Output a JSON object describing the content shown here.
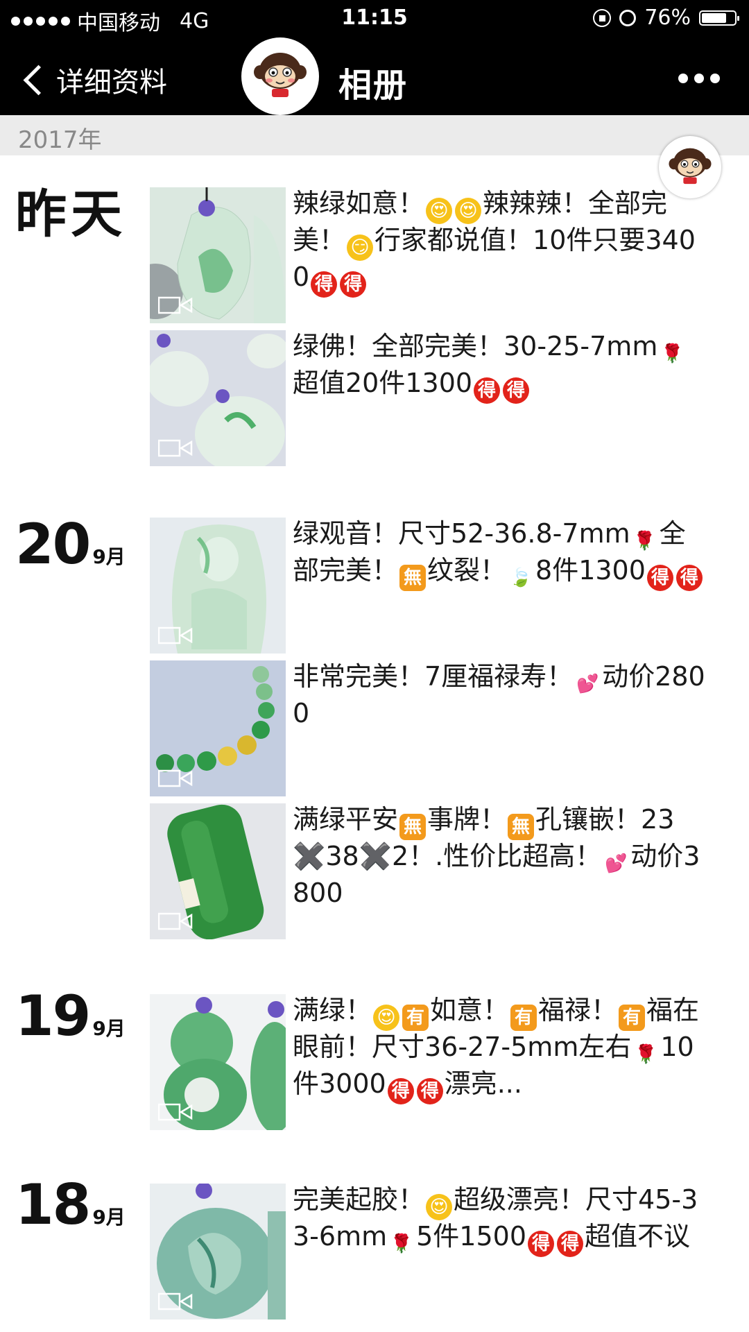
{
  "status": {
    "carrier": "中国移动",
    "network": "4G",
    "time": "11:15",
    "battery": "76%",
    "battery_level": 0.76
  },
  "nav": {
    "back_label": "详细资料",
    "title": "相册"
  },
  "year_label": "2017年",
  "days": [
    {
      "day": "昨天",
      "month": ""
    },
    {
      "day": "20",
      "month": "9月"
    },
    {
      "day": "19",
      "month": "9月"
    },
    {
      "day": "18",
      "month": "9月"
    }
  ],
  "posts": [
    {
      "segments": [
        {
          "t": "辣绿如意！"
        },
        {
          "e": "face",
          "g": "😍"
        },
        {
          "e": "face",
          "g": "😍"
        },
        {
          "t": "辣辣辣！全部完美！"
        },
        {
          "e": "face",
          "g": "😏"
        },
        {
          "t": "行家都说值！10件只要3400"
        },
        {
          "e": "de",
          "g": "得"
        },
        {
          "e": "de",
          "g": "得"
        }
      ]
    },
    {
      "segments": [
        {
          "t": "绿佛！全部完美！30-25-7mm"
        },
        {
          "e": "rose",
          "g": "🌹"
        },
        {
          "t": "超值20件1300"
        },
        {
          "e": "de",
          "g": "得"
        },
        {
          "e": "de",
          "g": "得"
        }
      ]
    },
    {
      "segments": [
        {
          "t": "绿观音！尺寸52-36.8-7mm"
        },
        {
          "e": "rose",
          "g": "🌹"
        },
        {
          "t": "全部完美！"
        },
        {
          "e": "wu",
          "g": "無"
        },
        {
          "t": "纹裂！"
        },
        {
          "e": "leaf",
          "g": "🍃"
        },
        {
          "t": "8件1300"
        },
        {
          "e": "de",
          "g": "得"
        },
        {
          "e": "de",
          "g": "得"
        }
      ]
    },
    {
      "segments": [
        {
          "t": "非常完美！7厘福禄寿！"
        },
        {
          "e": "heart",
          "g": "💕"
        },
        {
          "t": "动价2800"
        }
      ]
    },
    {
      "segments": [
        {
          "t": "满绿平安"
        },
        {
          "e": "wu",
          "g": "無"
        },
        {
          "t": "事牌！"
        },
        {
          "e": "wu",
          "g": "無"
        },
        {
          "t": "孔镶嵌！23✖️38✖️2！.性价比超高！"
        },
        {
          "e": "heart",
          "g": "💕"
        },
        {
          "t": "动价3800"
        }
      ]
    },
    {
      "segments": [
        {
          "t": "满绿！"
        },
        {
          "e": "face",
          "g": "😍"
        },
        {
          "e": "you",
          "g": "有"
        },
        {
          "t": "如意！"
        },
        {
          "e": "you",
          "g": "有"
        },
        {
          "t": "福禄！"
        },
        {
          "e": "you",
          "g": "有"
        },
        {
          "t": "福在眼前！尺寸36-27-5mm左右"
        },
        {
          "e": "rose",
          "g": "🌹"
        },
        {
          "t": "10件3000"
        },
        {
          "e": "de",
          "g": "得"
        },
        {
          "e": "de",
          "g": "得"
        },
        {
          "t": "漂亮..."
        }
      ]
    },
    {
      "segments": [
        {
          "t": "完美起胶！"
        },
        {
          "e": "face",
          "g": "😍"
        },
        {
          "t": "超级漂亮！尺寸45-33-6mm"
        },
        {
          "e": "rose",
          "g": "🌹"
        },
        {
          "t": "5件1500"
        },
        {
          "e": "de",
          "g": "得"
        },
        {
          "e": "de",
          "g": "得"
        },
        {
          "t": "超值不议"
        }
      ]
    }
  ],
  "colors": {
    "bar": "#000000",
    "yearbar": "#ebebeb",
    "jade_light": "#cfe8d6",
    "jade_green": "#3aa35a"
  }
}
